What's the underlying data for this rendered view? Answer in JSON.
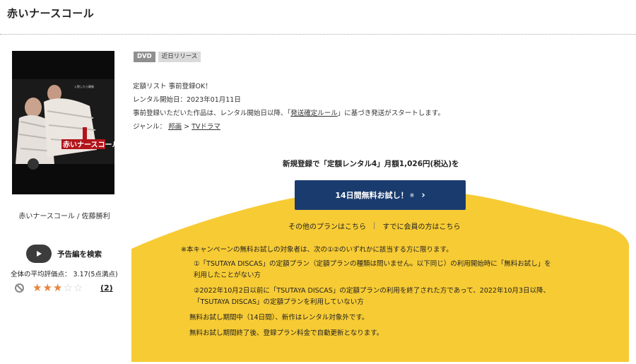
{
  "page": {
    "title": "赤いナースコール"
  },
  "cover": {
    "alt": "赤いナースコール",
    "tagline": "入院したら最後",
    "title_art": "赤いナースコール"
  },
  "cover_caption": "赤いナースコール / 佐藤勝利",
  "trailer": {
    "label": "予告編を検索",
    "icon": "play-icon"
  },
  "rating": {
    "average_text": "全体の平均評価点： 3.17(5点満点)",
    "stars_filled": 3,
    "stars_total": 5,
    "review_count": "(2)",
    "colors": {
      "filled": "#e8843e",
      "empty": "#cfcfcf"
    }
  },
  "badges": {
    "format": "DVD",
    "status": "近日リリース"
  },
  "info": {
    "list_status": "定額リスト 事前登録OK！",
    "rental_start": "レンタル開始日：2023年01月11日",
    "notice_before": "事前登録いただいた作品は、レンタル開始日以降、「",
    "notice_link": "発送確定ルール",
    "notice_after": "」に基づき発送がスタートします。",
    "genre_label": "ジャンル：",
    "genre_parent": "邦画",
    "genre_sep": ">",
    "genre_child": "TVドラマ"
  },
  "offer": {
    "headline": "新規登録で「定額レンタル4」月額1,026円(税込)を",
    "cta_label": "14日間無料お試し！",
    "cta_note": "※",
    "cta_chevron": "›",
    "other_plans": "その他のプランはこちら",
    "separator": "|",
    "members": "すでに会員の方はこちら"
  },
  "notes": {
    "intro": "※本キャンペーンの無料お試しの対象者は、次の①②のいずれかに該当する方に限ります。",
    "item1_line1": "①「TSUTAYA DISCAS」の定額プラン（定額プランの種類は問いません。以下同じ）の利用開始時に「無料お試し」を",
    "item1_line2": "利用したことがない方",
    "item2_line1": "②2022年10月2日以前に「TSUTAYA DISCAS」の定額プランの利用を終了された方であって、2022年10月3日以降、",
    "item2_line2": "「TSUTAYA DISCAS」の定額プランを利用していない方",
    "trial_period": "無料お試し期間中（14日間）、新作はレンタル対象外です。",
    "auto_renew": "無料お試し期間終了後、登録プラン料金で自動更新となります。"
  },
  "colors": {
    "accent_navy": "#1a3b6e",
    "campaign_yellow": "#f7cb34",
    "badge_dvd": "#8f8f8f",
    "badge_new": "#dadada"
  }
}
